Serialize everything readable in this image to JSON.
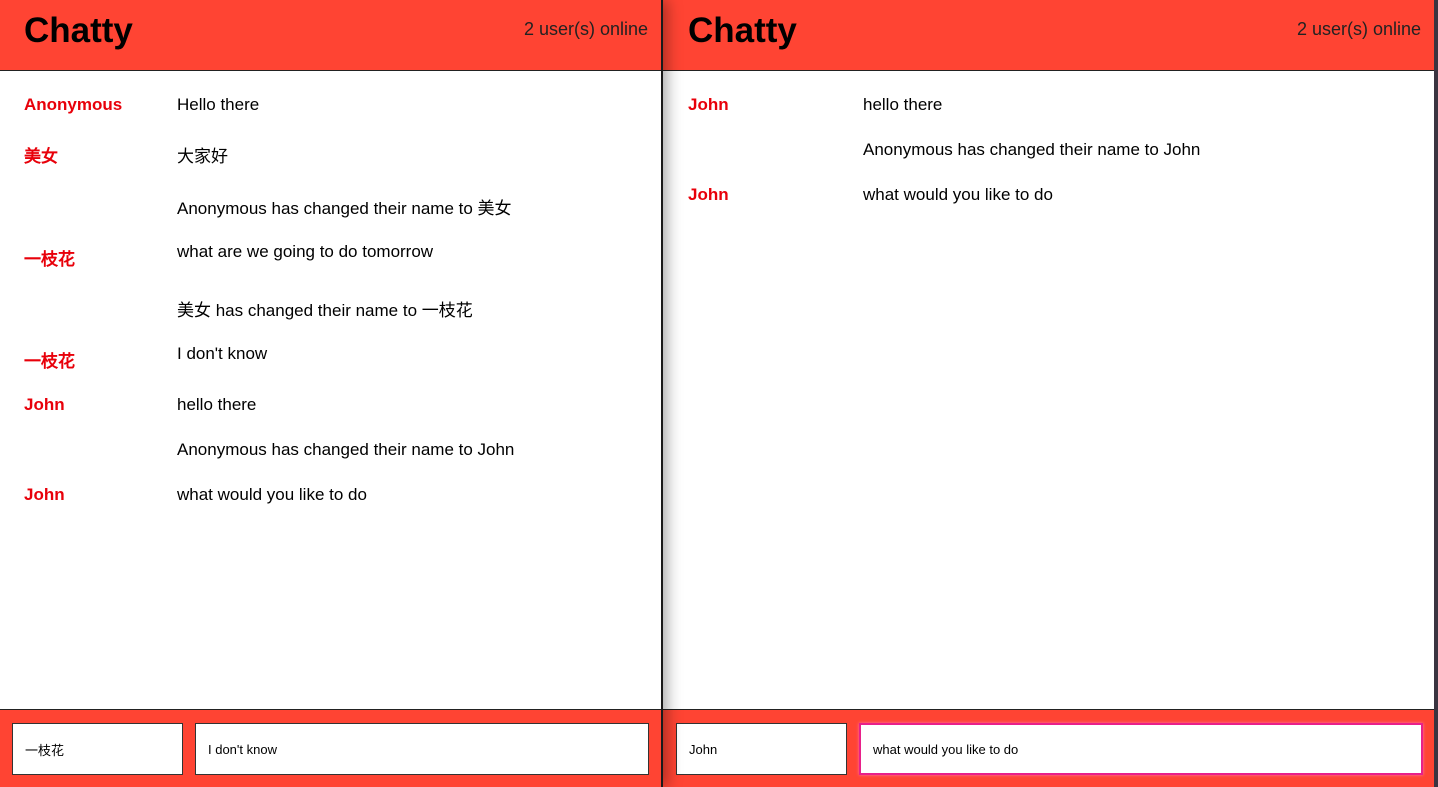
{
  "left": {
    "brand": "Chatty",
    "user_count": "2 user(s) online",
    "messages": [
      {
        "user": "Anonymous",
        "text": "Hello there"
      },
      {
        "user": "美女",
        "text": "大家好"
      },
      {
        "user": "",
        "text": "Anonymous has changed their name to 美女"
      },
      {
        "user": "一枝花",
        "text": "what are we going to do tomorrow"
      },
      {
        "user": "",
        "text": "美女 has changed their name to 一枝花"
      },
      {
        "user": "一枝花",
        "text": "I don't know"
      },
      {
        "user": "John",
        "text": "hello there"
      },
      {
        "user": "",
        "text": "Anonymous has changed their name to John"
      },
      {
        "user": "John",
        "text": "what would you like to do"
      }
    ],
    "name_input_value": "一枝花",
    "message_input_value": "I don't know"
  },
  "right": {
    "brand": "Chatty",
    "user_count": "2 user(s) online",
    "messages": [
      {
        "user": "John",
        "text": "hello there"
      },
      {
        "user": "",
        "text": "Anonymous has changed their name to John"
      },
      {
        "user": "John",
        "text": "what would you like to do"
      }
    ],
    "name_input_value": "John",
    "message_input_value": "what would you like to do"
  },
  "colors": {
    "navbar": "#ff4433",
    "username": "#e8000a",
    "focus_border": "#e8208a"
  }
}
